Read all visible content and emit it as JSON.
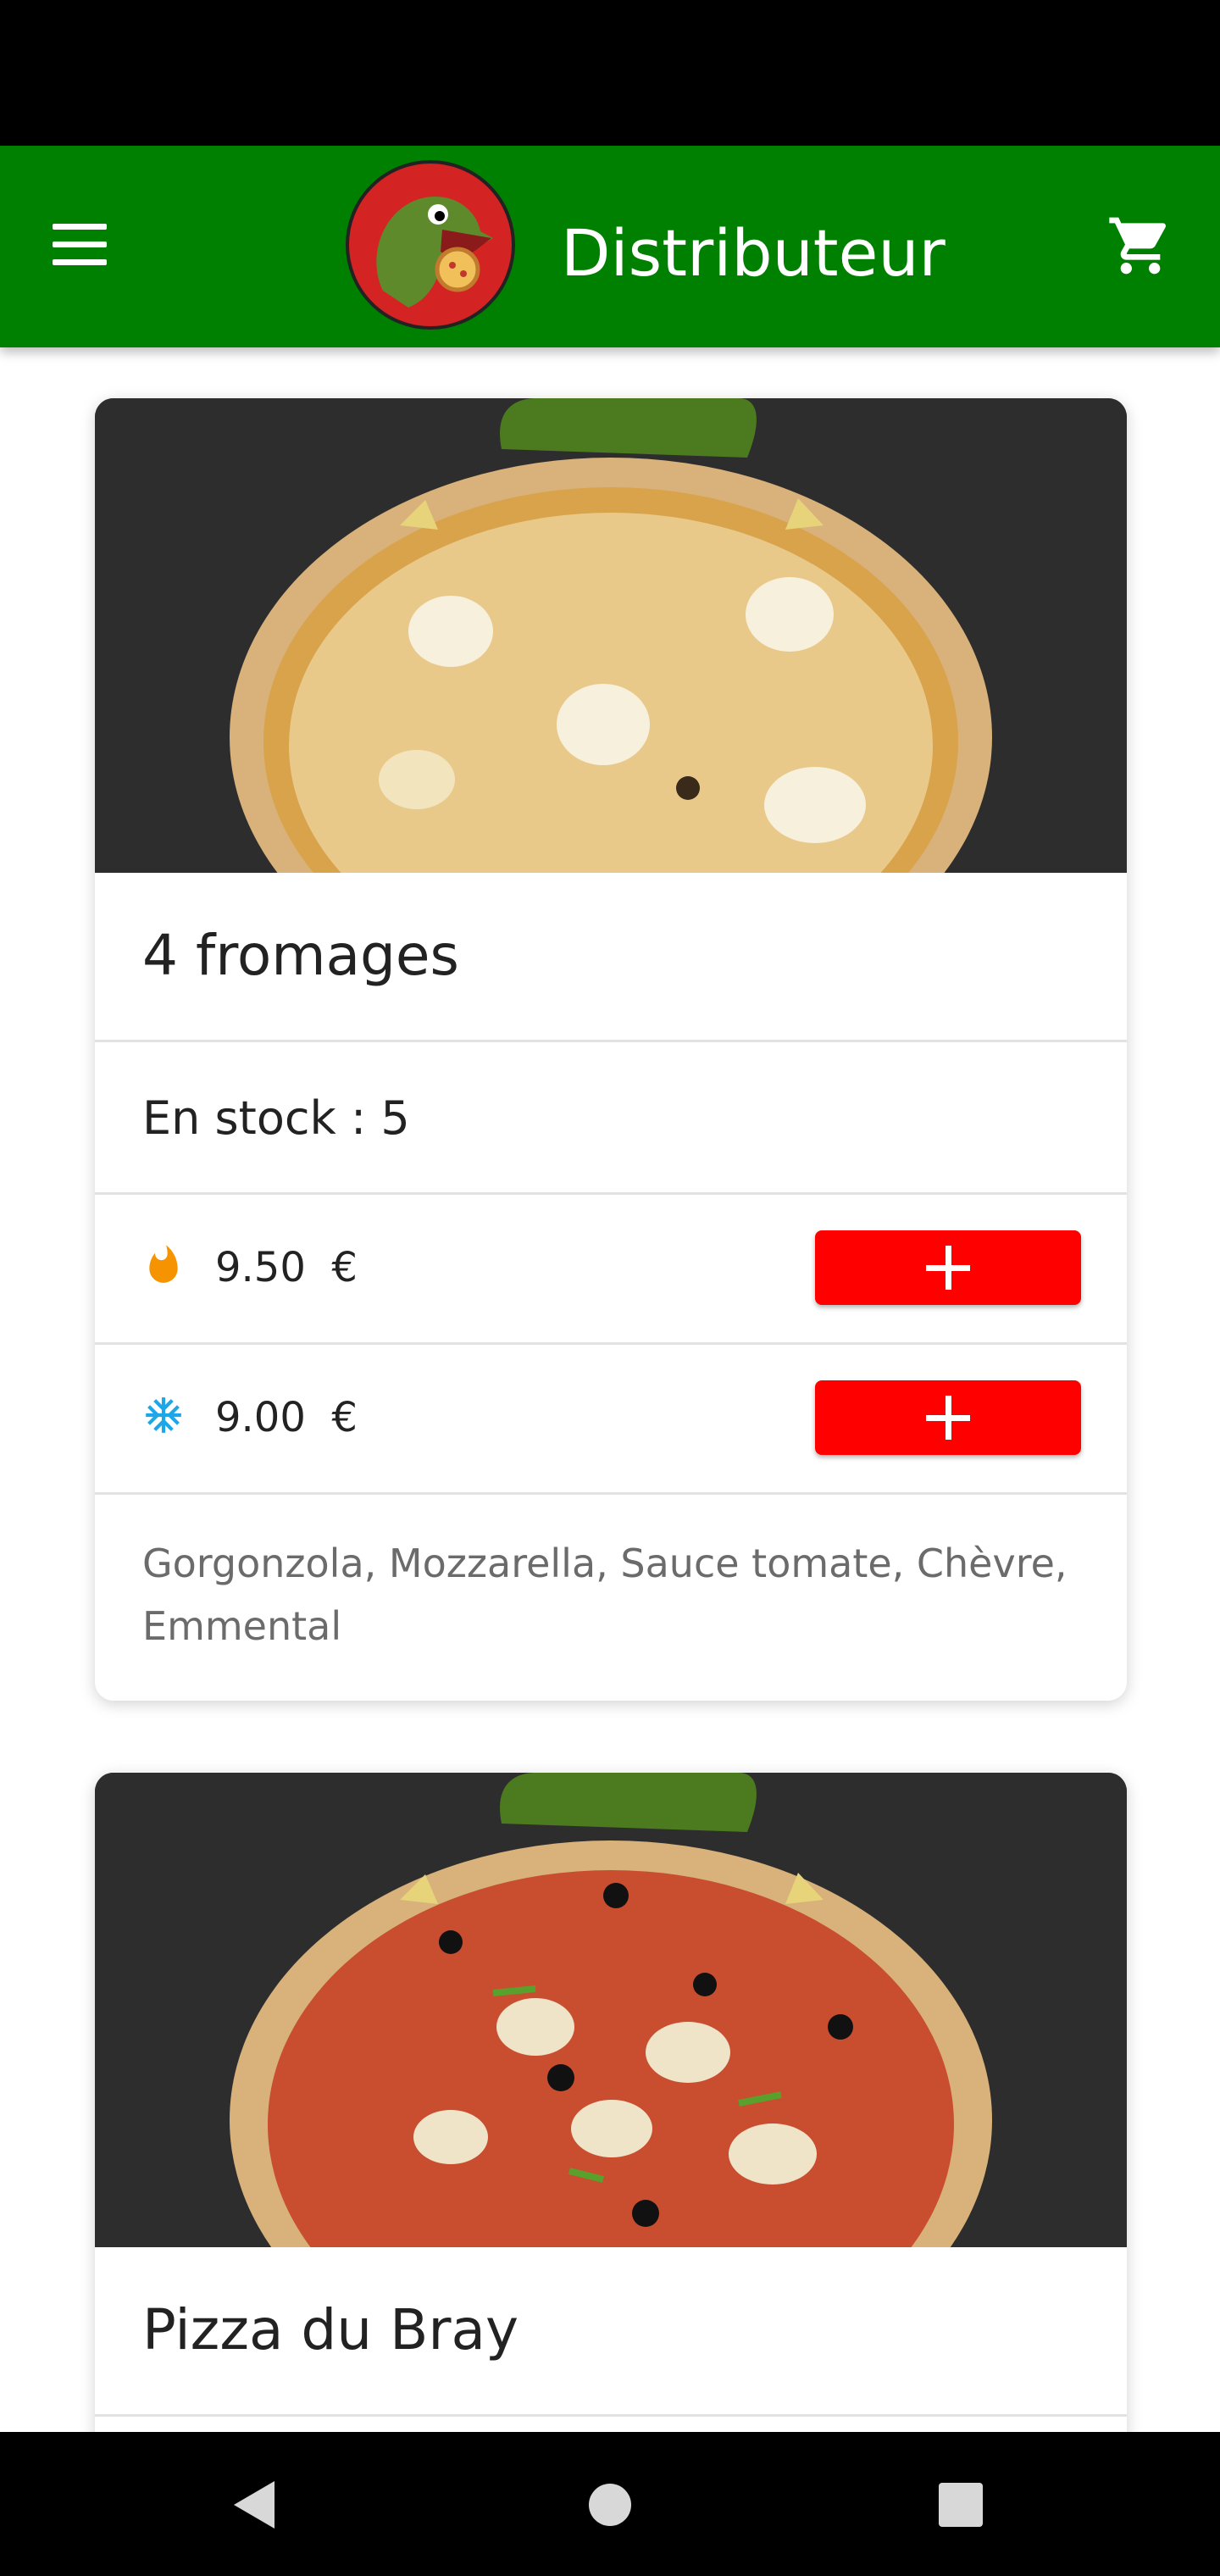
{
  "colors": {
    "brand": "#008000",
    "accent": "#ff0000",
    "hot_icon": "#f59300",
    "cold_icon": "#1ea7e8"
  },
  "header": {
    "title": "Distributeur",
    "menu_icon": "hamburger-menu-icon",
    "logo": "dinosaur-logo",
    "cart_icon": "shopping-cart-icon"
  },
  "products": [
    {
      "name": "4 fromages",
      "stock": "En stock : 5",
      "prices": [
        {
          "icon": "flame-icon",
          "amount": "9.50",
          "currency": "€"
        },
        {
          "icon": "snowflake-icon",
          "amount": "9.00",
          "currency": "€"
        }
      ],
      "description": "Gorgonzola, Mozzarella, Sauce tomate, Chèvre, Emmental"
    },
    {
      "name": "Pizza du Bray"
    }
  ],
  "system_nav": {
    "back": "back-triangle-icon",
    "home": "home-circle-icon",
    "recents": "recents-square-icon"
  }
}
